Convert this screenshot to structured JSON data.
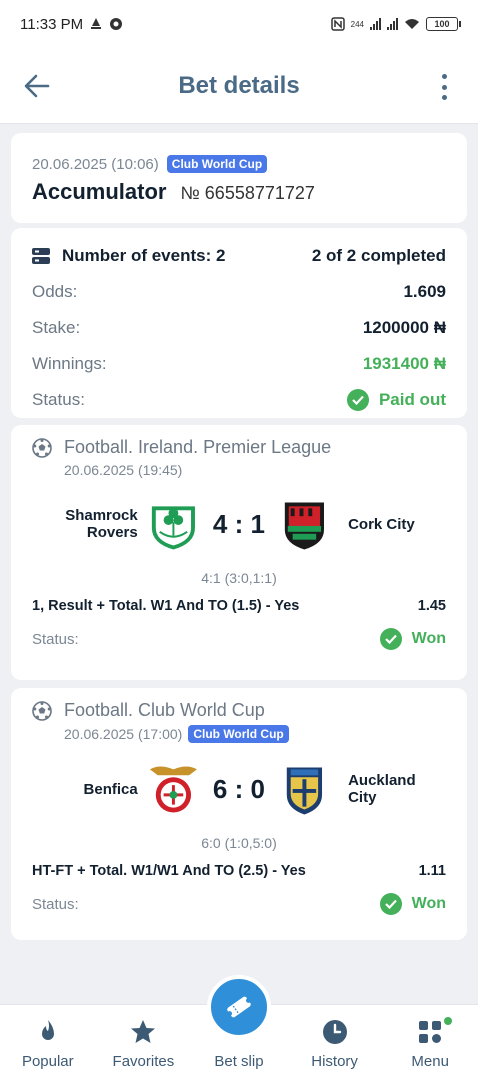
{
  "status_bar": {
    "time": "11:33 PM",
    "net_speed": "244",
    "battery": "100"
  },
  "app_bar": {
    "title": "Bet details"
  },
  "summary": {
    "datetime": "20.06.2025 (10:06)",
    "badge": "Club World Cup",
    "bet_type": "Accumulator",
    "bet_number": "№ 66558771727"
  },
  "details": {
    "events_label": "Number of events: 2",
    "completed": "2 of 2 completed",
    "odds_label": "Odds:",
    "odds_value": "1.609",
    "stake_label": "Stake:",
    "stake_value": "1200000 ₦",
    "winnings_label": "Winnings:",
    "winnings_value": "1931400 ₦",
    "status_label": "Status:",
    "status_value": "Paid out"
  },
  "events": [
    {
      "league": "Football. Ireland. Premier League",
      "datetime": "20.06.2025 (19:45)",
      "badge": "",
      "home": "Shamrock Rovers",
      "away": "Cork City",
      "score": "4 : 1",
      "halves": "4:1 (3:0,1:1)",
      "market": "1, Result + Total. W1 And TO (1.5) - Yes",
      "odd": "1.45",
      "status_label": "Status:",
      "status": "Won"
    },
    {
      "league": "Football. Club World Cup",
      "datetime": "20.06.2025 (17:00)",
      "badge": "Club World Cup",
      "home": "Benfica",
      "away": "Auckland City",
      "score": "6 : 0",
      "halves": "6:0 (1:0,5:0)",
      "market": "HT-FT + Total. W1/W1 And TO (2.5) - Yes",
      "odd": "1.11",
      "status_label": "Status:",
      "status": "Won"
    }
  ],
  "tabs": {
    "popular": "Popular",
    "favorites": "Favorites",
    "bet_slip": "Bet slip",
    "history": "History",
    "menu": "Menu"
  },
  "colors": {
    "accent": "#2f8fd8",
    "won": "#45b05a",
    "badge": "#4a78e8",
    "title": "#4a6a86"
  }
}
